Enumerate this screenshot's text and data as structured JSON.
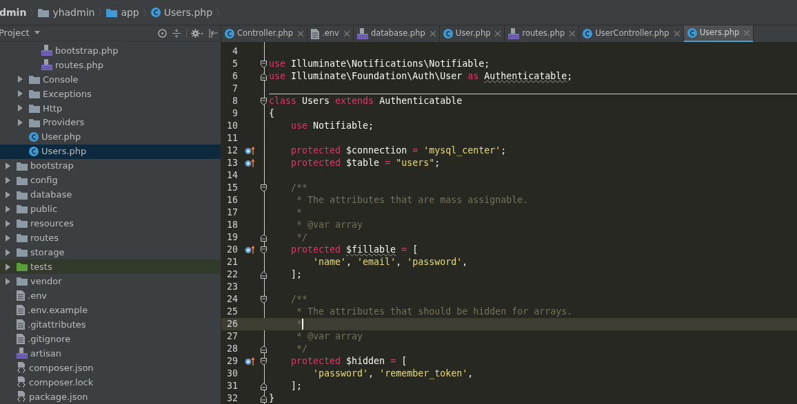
{
  "breadcrumbs": [
    {
      "label": "dmin",
      "kind": "text"
    },
    {
      "label": "yhadmin",
      "kind": "folder"
    },
    {
      "label": "app",
      "kind": "source-folder"
    },
    {
      "label": "Users.php",
      "kind": "class"
    }
  ],
  "project_panel": {
    "title": "Project",
    "tree": [
      {
        "children": [
          {
            "children": [
              {
                "name": "bootstrap.php",
                "kind": "php",
                "selected": false
              },
              {
                "name": "routes.php",
                "kind": "php",
                "selected": false
              }
            ]
          },
          {
            "name": "Console",
            "kind": "folder",
            "expanded": false,
            "selected": false
          },
          {
            "name": "Exceptions",
            "kind": "folder",
            "expanded": false,
            "selected": false
          },
          {
            "name": "Http",
            "kind": "folder",
            "expanded": false,
            "selected": false
          },
          {
            "name": "Providers",
            "kind": "folder",
            "expanded": false,
            "selected": false
          },
          {
            "name": "User.php",
            "kind": "class",
            "selected": false
          },
          {
            "name": "Users.php",
            "kind": "class",
            "selected": true
          }
        ]
      },
      {
        "name": "bootstrap",
        "kind": "folder",
        "expanded": false,
        "selected": false
      },
      {
        "name": "config",
        "kind": "folder",
        "expanded": false,
        "selected": false
      },
      {
        "name": "database",
        "kind": "folder",
        "expanded": false,
        "selected": false
      },
      {
        "name": "public",
        "kind": "folder",
        "expanded": false,
        "selected": false
      },
      {
        "name": "resources",
        "kind": "folder",
        "expanded": false,
        "selected": false
      },
      {
        "name": "routes",
        "kind": "folder",
        "expanded": false,
        "selected": false
      },
      {
        "name": "storage",
        "kind": "folder",
        "expanded": false,
        "selected": false
      },
      {
        "name": "tests",
        "kind": "test-folder",
        "expanded": false,
        "selected": false
      },
      {
        "name": "vendor",
        "kind": "folder",
        "expanded": false,
        "selected": false
      },
      {
        "name": ".env",
        "kind": "text",
        "selected": false
      },
      {
        "name": ".env.example",
        "kind": "text",
        "selected": false
      },
      {
        "name": ".gitattributes",
        "kind": "text",
        "selected": false
      },
      {
        "name": ".gitignore",
        "kind": "text",
        "selected": false
      },
      {
        "name": "artisan",
        "kind": "php",
        "selected": false
      },
      {
        "name": "composer.json",
        "kind": "json",
        "selected": false
      },
      {
        "name": "composer.lock",
        "kind": "json",
        "selected": false
      },
      {
        "name": "package.json",
        "kind": "json",
        "selected": false
      }
    ]
  },
  "tabs": [
    {
      "label": "Controller.php",
      "kind": "class",
      "selected": false
    },
    {
      "label": ".env",
      "kind": "text",
      "selected": false
    },
    {
      "label": "database.php",
      "kind": "php",
      "selected": false
    },
    {
      "label": "User.php",
      "kind": "class",
      "selected": false
    },
    {
      "label": "routes.php",
      "kind": "php",
      "selected": false
    },
    {
      "label": "UserController.php",
      "kind": "class",
      "selected": false
    },
    {
      "label": "Users.php",
      "kind": "class",
      "selected": true
    }
  ],
  "editor": {
    "lines": [
      {
        "number": "4"
      },
      {
        "number": "5",
        "fold": {
          "kind": "start"
        },
        "tokens": [
          {
            "t": "use",
            "kind": "kw"
          },
          {
            "t": " Illuminate\\Notifications\\Notifiable;",
            "kind": "plain"
          }
        ]
      },
      {
        "number": "6",
        "fold": {
          "kind": "end"
        },
        "tokens": [
          {
            "t": "use",
            "kind": "kw"
          },
          {
            "t": " Illuminate\\Foundation\\Auth\\User ",
            "kind": "plain"
          },
          {
            "t": "as ",
            "kind": "kw"
          },
          {
            "t": "Authenticatable",
            "kind": "warn"
          },
          {
            "t": ";",
            "kind": "plain"
          }
        ]
      },
      {
        "number": "7"
      },
      {
        "number": "8",
        "fold": {
          "kind": "start"
        },
        "separator": true,
        "tokens": [
          {
            "t": "class",
            "kind": "kw"
          },
          {
            "t": " Users ",
            "kind": "plain"
          },
          {
            "t": "extends",
            "kind": "kw"
          },
          {
            "t": " Authenticatable",
            "kind": "plain"
          }
        ]
      },
      {
        "number": "9",
        "tokens": [
          {
            "t": "{",
            "kind": "plain"
          }
        ]
      },
      {
        "number": "10",
        "tokens": [
          {
            "t": "    use",
            "kind": "kw"
          },
          {
            "t": " Notifiable;",
            "kind": "plain"
          }
        ]
      },
      {
        "number": "11"
      },
      {
        "number": "12",
        "marker": {
          "kind": "override"
        },
        "tokens": [
          {
            "t": "    protected",
            "kind": "kw"
          },
          {
            "t": " $connection ",
            "kind": "plain"
          },
          {
            "t": "= ",
            "kind": "kw"
          },
          {
            "t": "'mysql_center'",
            "kind": "str"
          },
          {
            "t": ";",
            "kind": "plain"
          }
        ]
      },
      {
        "number": "13",
        "marker": {
          "kind": "override"
        },
        "tokens": [
          {
            "t": "    protected",
            "kind": "kw"
          },
          {
            "t": " $table ",
            "kind": "plain"
          },
          {
            "t": "= ",
            "kind": "kw"
          },
          {
            "t": "\"users\"",
            "kind": "str"
          },
          {
            "t": ";",
            "kind": "plain"
          }
        ]
      },
      {
        "number": "14"
      },
      {
        "number": "15",
        "fold": {
          "kind": "start"
        },
        "tokens": [
          {
            "t": "    /**",
            "kind": "cmt"
          }
        ]
      },
      {
        "number": "16",
        "tokens": [
          {
            "t": "     * The attributes that are mass assignable.",
            "kind": "cmt"
          }
        ]
      },
      {
        "number": "17",
        "tokens": [
          {
            "t": "     *",
            "kind": "cmt"
          }
        ]
      },
      {
        "number": "18",
        "tokens": [
          {
            "t": "     * @var array",
            "kind": "cmt"
          }
        ]
      },
      {
        "number": "19",
        "fold": {
          "kind": "end"
        },
        "tokens": [
          {
            "t": "     */",
            "kind": "cmt"
          }
        ]
      },
      {
        "number": "20",
        "marker": {
          "kind": "override"
        },
        "fold": {
          "kind": "start"
        },
        "tokens": [
          {
            "t": "    protected ",
            "kind": "kw"
          },
          {
            "t": "$fillable",
            "kind": "warn"
          },
          {
            "t": " =",
            "kind": "kw"
          },
          {
            "t": " [",
            "kind": "plain"
          }
        ]
      },
      {
        "number": "21",
        "tokens": [
          {
            "t": "        'name'",
            "kind": "str"
          },
          {
            "t": ", ",
            "kind": "plain"
          },
          {
            "t": "'email'",
            "kind": "str"
          },
          {
            "t": ", ",
            "kind": "plain"
          },
          {
            "t": "'password'",
            "kind": "str"
          },
          {
            "t": ",",
            "kind": "plain"
          }
        ]
      },
      {
        "number": "22",
        "fold": {
          "kind": "end"
        },
        "tokens": [
          {
            "t": "    ];",
            "kind": "plain"
          }
        ]
      },
      {
        "number": "23"
      },
      {
        "number": "24",
        "fold": {
          "kind": "start"
        },
        "tokens": [
          {
            "t": "    /**",
            "kind": "cmt"
          }
        ]
      },
      {
        "number": "25",
        "tokens": [
          {
            "t": "     * The attributes that should be hidden for arrays.",
            "kind": "cmt"
          }
        ]
      },
      {
        "number": "26",
        "current": true,
        "tokens": [
          {
            "t": "     *",
            "kind": "cmt"
          }
        ]
      },
      {
        "number": "27",
        "tokens": [
          {
            "t": "     * @var array",
            "kind": "cmt"
          }
        ]
      },
      {
        "number": "28",
        "fold": {
          "kind": "end"
        },
        "tokens": [
          {
            "t": "     */",
            "kind": "cmt"
          }
        ]
      },
      {
        "number": "29",
        "marker": {
          "kind": "override"
        },
        "fold": {
          "kind": "start"
        },
        "tokens": [
          {
            "t": "    protected",
            "kind": "kw"
          },
          {
            "t": " $hidden ",
            "kind": "plain"
          },
          {
            "t": "=",
            "kind": "kw"
          },
          {
            "t": " [",
            "kind": "plain"
          }
        ]
      },
      {
        "number": "30",
        "tokens": [
          {
            "t": "        'password'",
            "kind": "str"
          },
          {
            "t": ", ",
            "kind": "plain"
          },
          {
            "t": "'remember_token'",
            "kind": "str"
          },
          {
            "t": ",",
            "kind": "plain"
          }
        ]
      },
      {
        "number": "31",
        "fold": {
          "kind": "end"
        },
        "tokens": [
          {
            "t": "    ];",
            "kind": "plain"
          }
        ]
      },
      {
        "number": "32",
        "fold": {
          "kind": "end"
        },
        "tokens": [
          {
            "t": "}",
            "kind": "plain"
          }
        ]
      }
    ]
  }
}
